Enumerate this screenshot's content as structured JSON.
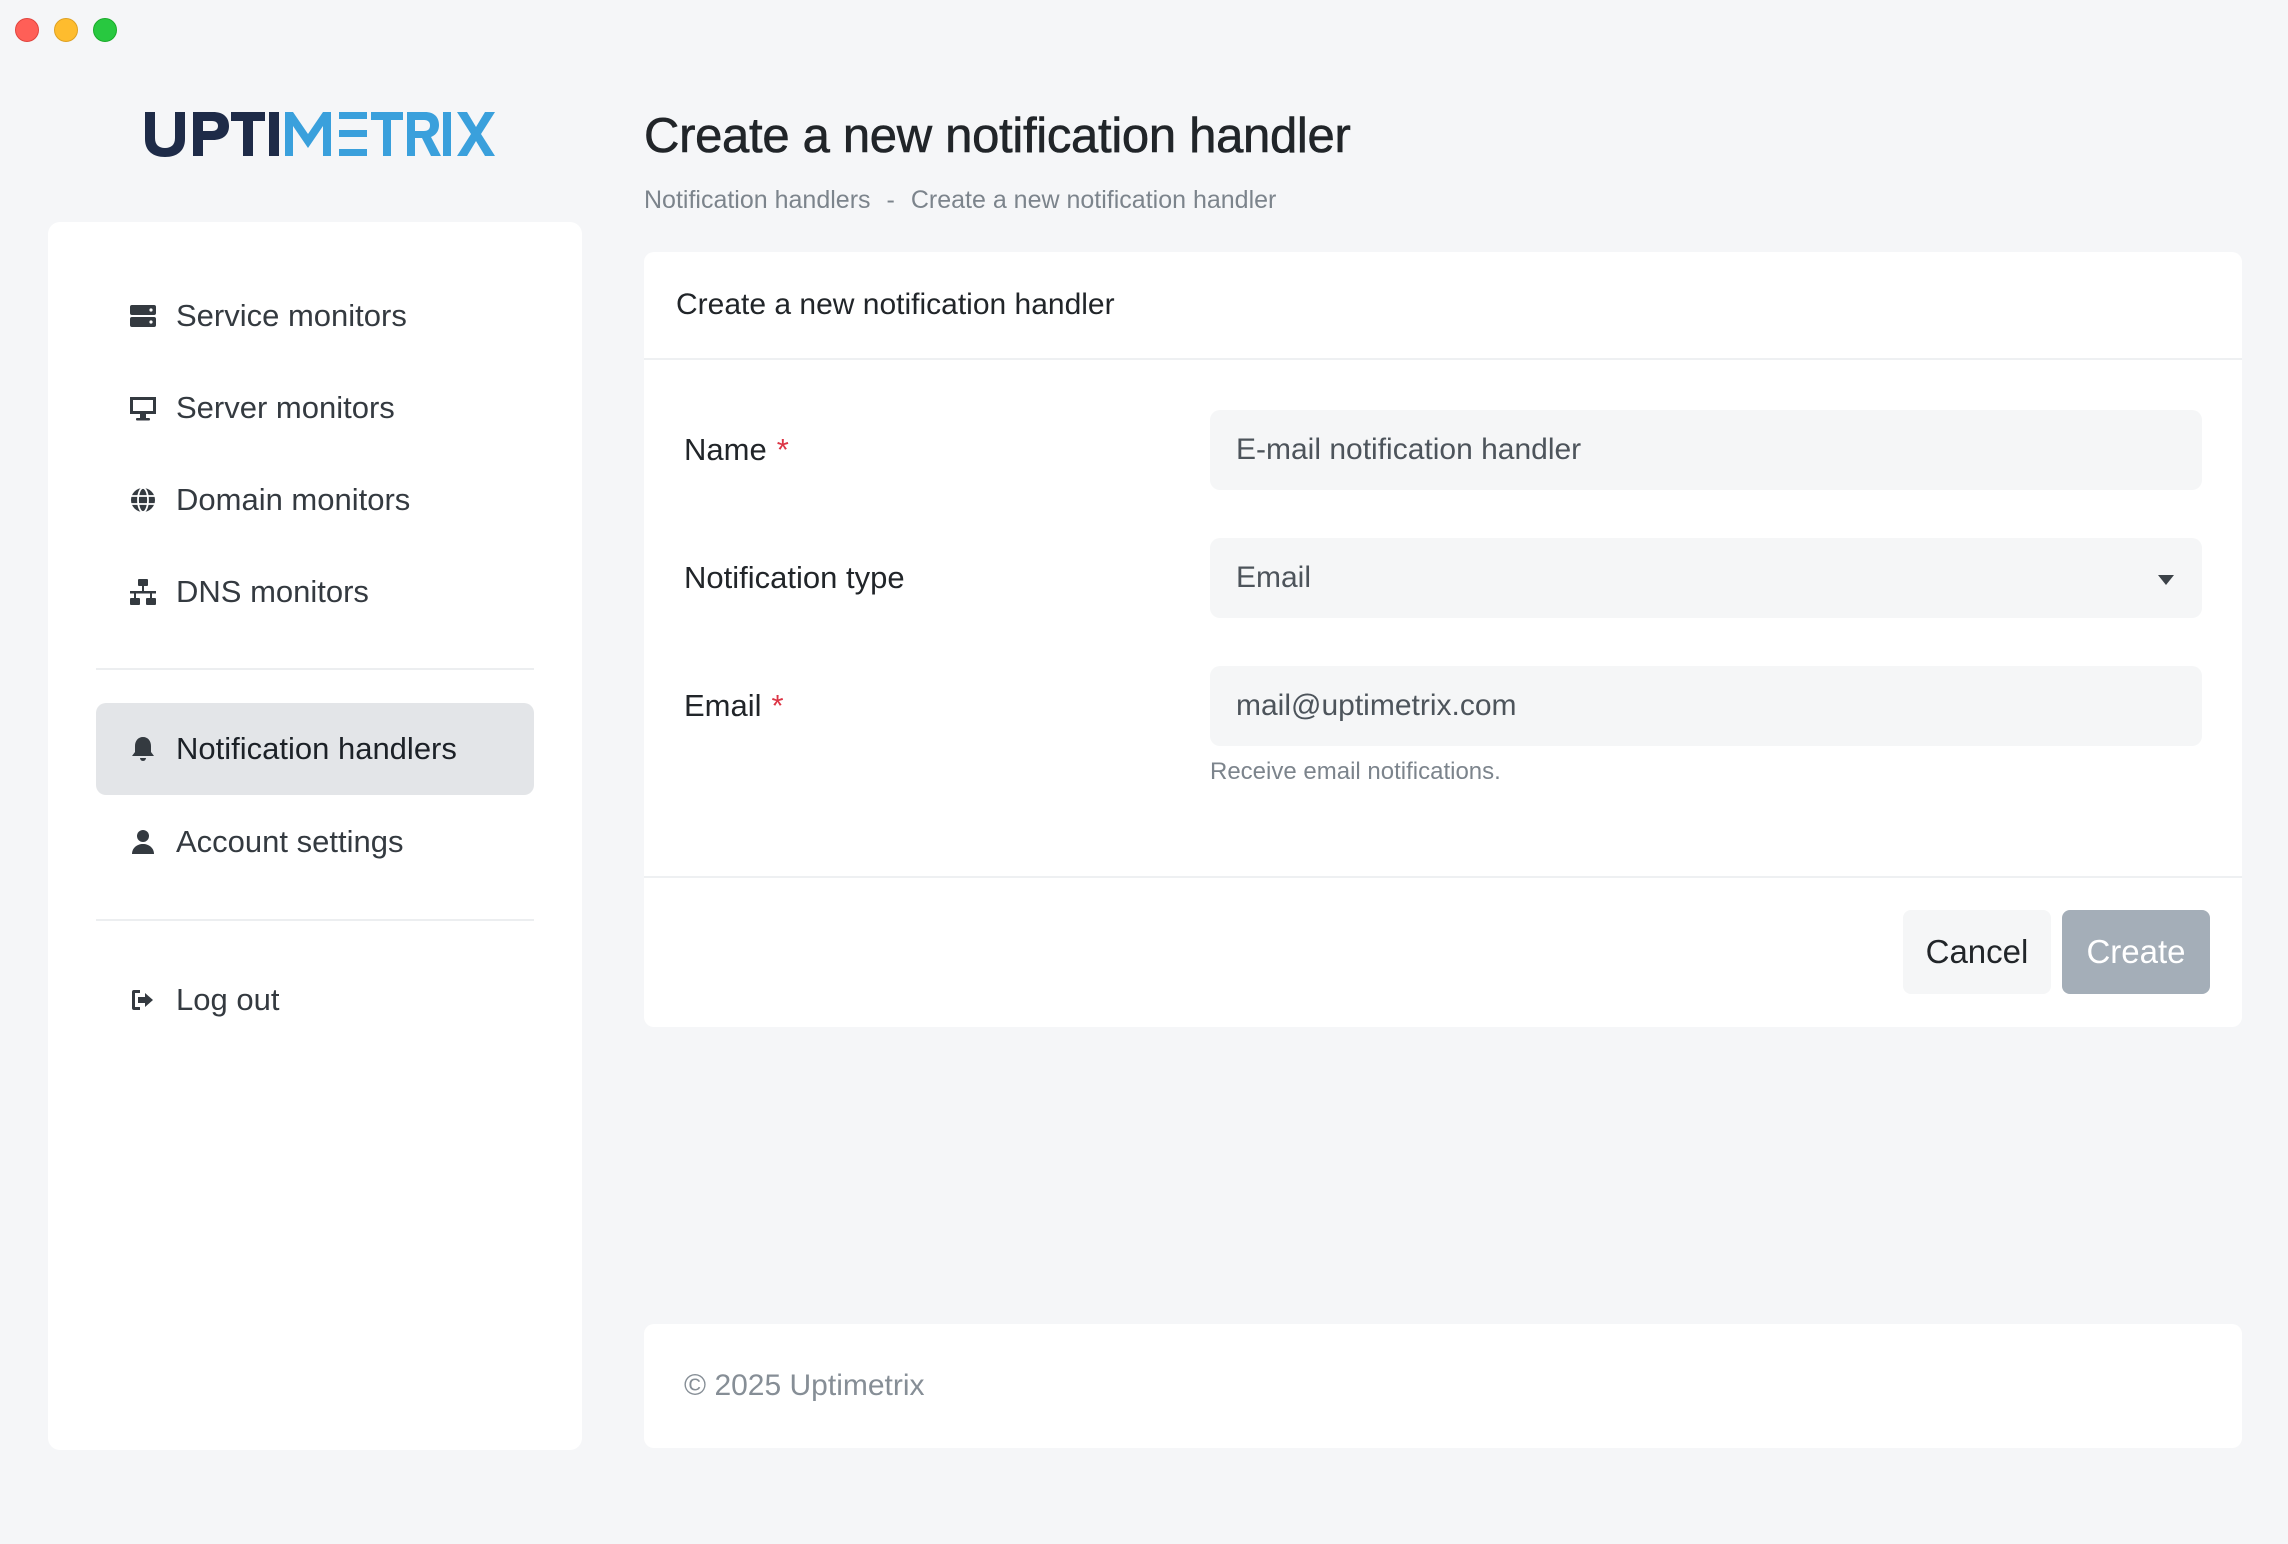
{
  "app": {
    "logo_text": "UPTIMETRIX",
    "brand_dark": "#1e2b48",
    "brand_light": "#3aa0dc"
  },
  "sidebar": {
    "items": [
      {
        "label": "Service monitors",
        "icon": "server-icon"
      },
      {
        "label": "Server monitors",
        "icon": "desktop-icon"
      },
      {
        "label": "Domain monitors",
        "icon": "globe-icon"
      },
      {
        "label": "DNS monitors",
        "icon": "network-icon"
      },
      {
        "label": "Notification handlers",
        "icon": "bell-icon",
        "active": true
      },
      {
        "label": "Account settings",
        "icon": "user-icon"
      },
      {
        "label": "Log out",
        "icon": "logout-icon"
      }
    ]
  },
  "header": {
    "title": "Create a new notification handler",
    "breadcrumb": {
      "parent": "Notification handlers",
      "separator": "-",
      "current": "Create a new notification handler"
    }
  },
  "form": {
    "card_title": "Create a new notification handler",
    "name_label": "Name",
    "required_mark": "*",
    "name_value": "E-mail notification handler",
    "type_label": "Notification type",
    "type_value": "Email",
    "email_label": "Email",
    "email_value": "mail@uptimetrix.com",
    "email_help": "Receive email notifications.",
    "cancel_label": "Cancel",
    "create_label": "Create"
  },
  "footer": {
    "copyright": "© 2025 Uptimetrix"
  }
}
